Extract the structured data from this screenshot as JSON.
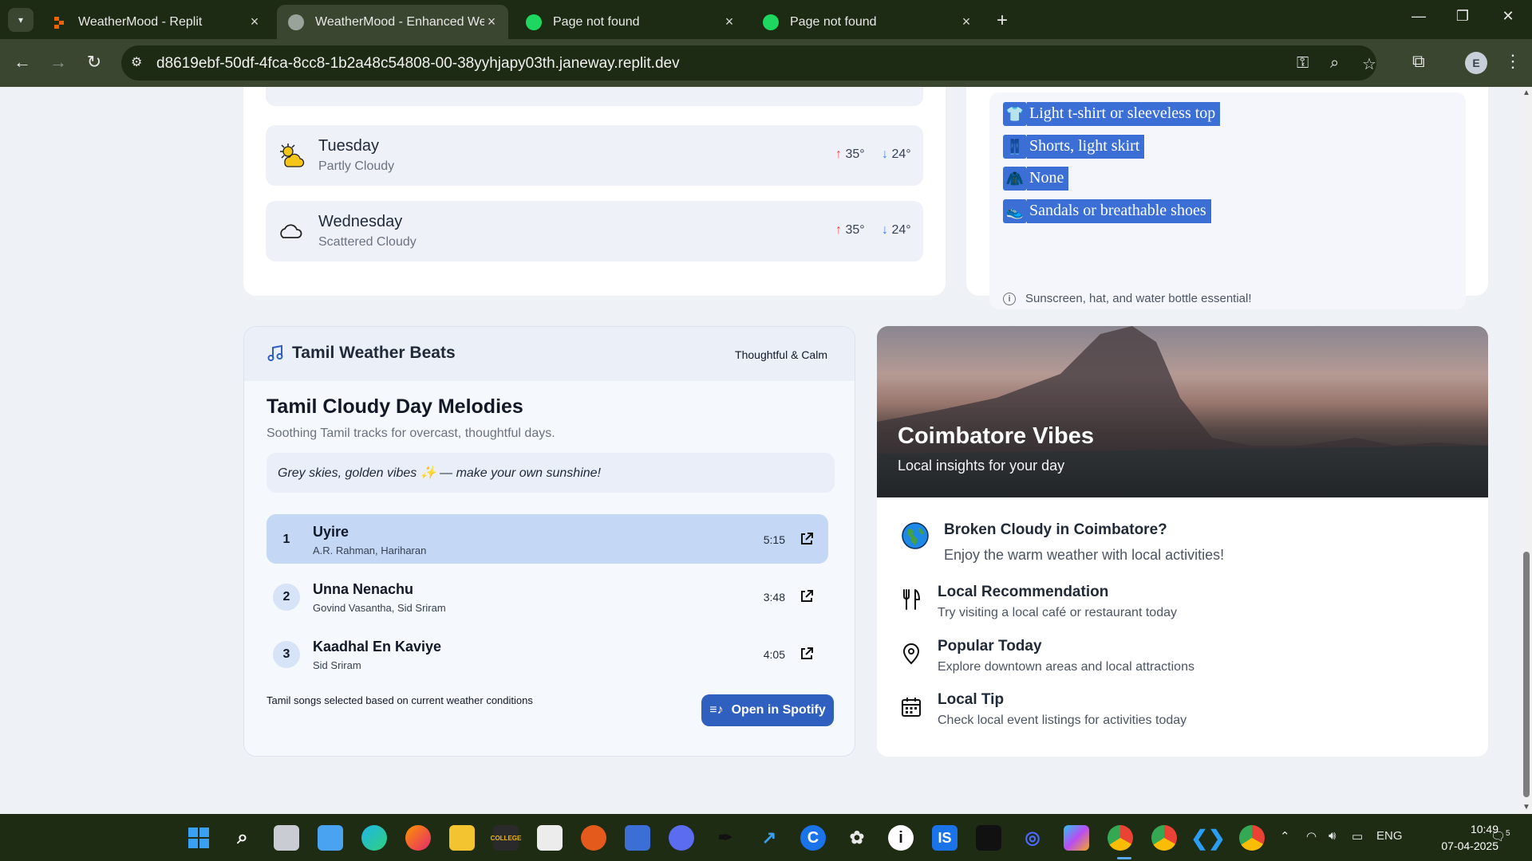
{
  "browser": {
    "tabs": [
      {
        "title": "WeatherMood - Replit",
        "active": false,
        "favicon": "replit-icon"
      },
      {
        "title": "WeatherMood - Enhanced Wea",
        "active": true,
        "favicon": "globe-icon"
      },
      {
        "title": "Page not found",
        "active": false,
        "favicon": "spotify-icon"
      },
      {
        "title": "Page not found",
        "active": false,
        "favicon": "spotify-icon"
      }
    ],
    "url": "d8619ebf-50df-4fca-8cc8-1b2a48c54808-00-38yyhjapy03th.janeway.replit.dev",
    "profile_initial": "E"
  },
  "forecast": {
    "days": [
      {
        "name": "Tuesday",
        "condition": "Partly Cloudy",
        "high": "35°",
        "low": "24°",
        "icon": "partly-cloudy-icon"
      },
      {
        "name": "Wednesday",
        "condition": "Scattered Cloudy",
        "high": "35°",
        "low": "24°",
        "icon": "cloud-icon"
      }
    ]
  },
  "outfit": {
    "items": [
      {
        "emoji": "👕",
        "text": "Light t-shirt or sleeveless top"
      },
      {
        "emoji": "👖",
        "text": "Shorts, light skirt"
      },
      {
        "emoji": "🧥",
        "text": "None"
      },
      {
        "emoji": "👟",
        "text": "Sandals or breathable shoes"
      }
    ],
    "note": "Sunscreen, hat, and water bottle essential!"
  },
  "music": {
    "header_title": "Tamil Weather Beats",
    "mood": "Thoughtful & Calm",
    "playlist_title": "Tamil Cloudy Day Melodies",
    "playlist_subtitle": "Soothing Tamil tracks for overcast, thoughtful days.",
    "quote": "Grey skies, golden vibes ✨ — make your own sunshine!",
    "tracks": [
      {
        "num": "1",
        "name": "Uyire",
        "artist": "A.R. Rahman, Hariharan",
        "duration": "5:15"
      },
      {
        "num": "2",
        "name": "Unna Nenachu",
        "artist": "Govind Vasantha, Sid Sriram",
        "duration": "3:48"
      },
      {
        "num": "3",
        "name": "Kaadhal En Kaviye",
        "artist": "Sid Sriram",
        "duration": "4:05"
      }
    ],
    "footer": "Tamil songs selected based on current weather conditions",
    "spotify_button": "Open in Spotify"
  },
  "local": {
    "hero_title": "Coimbatore Vibes",
    "hero_subtitle": "Local insights for your day",
    "feature_title": "Broken Cloudy in Coimbatore?",
    "feature_text": "Enjoy the warm weather with local activities!",
    "items": [
      {
        "title": "Local Recommendation",
        "text": "Try visiting a local café or restaurant today",
        "icon": "utensils-icon"
      },
      {
        "title": "Popular Today",
        "text": "Explore downtown areas and local attractions",
        "icon": "map-pin-icon"
      },
      {
        "title": "Local Tip",
        "text": "Check local event listings for activities today",
        "icon": "calendar-icon"
      }
    ]
  },
  "taskbar": {
    "language": "ENG",
    "time": "10:49",
    "date": "07-04-2025",
    "notification_count": "5"
  }
}
